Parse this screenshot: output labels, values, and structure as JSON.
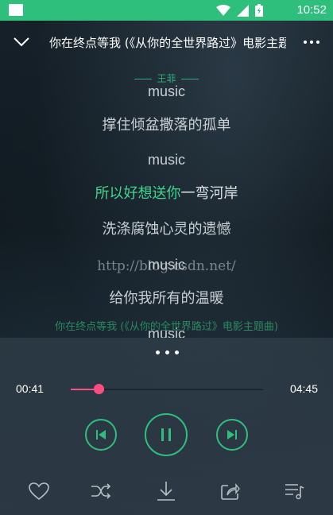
{
  "status_bar": {
    "time": "10:52"
  },
  "header": {
    "title": "你在终点等我 (《从你的全世界路过》电影主题曲)",
    "back_icon": "chevron-down-icon",
    "more_icon": "more-horizontal-icon"
  },
  "lyrics": {
    "artist": "王菲",
    "lines": [
      "music",
      "撑住倾盆撒落的孤单",
      "music",
      "一弯河岸",
      "洗涤腐蚀心灵的遗憾",
      "music",
      "给你我所有的温暖",
      "music"
    ],
    "current_sung": "所以好想送你",
    "watermark": "http://blog.csdn.net/",
    "song_caption": "你在终点等我 (《从你的全世界路过》电影主题曲)"
  },
  "player": {
    "current_time": "00:41",
    "total_time": "04:45",
    "progress": 0.145,
    "accent_color": "#2fbf7d",
    "progress_color": "#ff4d82"
  },
  "actions": [
    "heart-icon",
    "shuffle-icon",
    "download-icon",
    "share-icon",
    "playlist-icon"
  ]
}
